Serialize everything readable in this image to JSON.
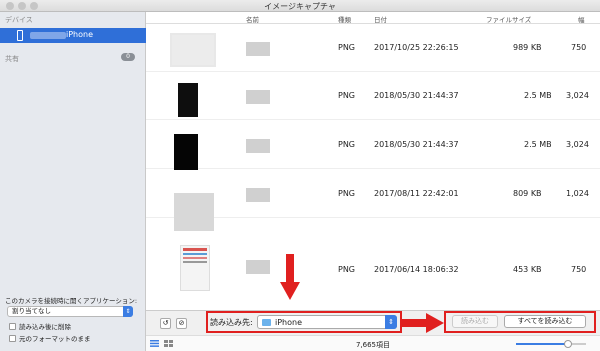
{
  "window": {
    "title": "イメージキャプチャ"
  },
  "sidebar": {
    "devices_header": "デバイス",
    "device_label": "iPhone",
    "shared_header": "共有",
    "shared_count": "0",
    "open_app_caption": "このカメラを接続時に開くアプリケーション:",
    "open_app_value": "割り当てなし",
    "delete_after_import": "読み込み後に削除",
    "keep_originals": "元のフォーマットのまま"
  },
  "table": {
    "headers": {
      "name": "名前",
      "kind": "種類",
      "date": "日付",
      "size": "ファイルサイズ",
      "width": "幅"
    },
    "rows": [
      {
        "kind": "PNG",
        "date": "2017/10/25 22:26:15",
        "size": "989 KB",
        "width": "750",
        "thumb_style": "light"
      },
      {
        "kind": "PNG",
        "date": "2018/05/30 21:44:37",
        "size": "2.5 MB",
        "width": "3,024",
        "thumb_style": "dark"
      },
      {
        "kind": "PNG",
        "date": "2018/05/30 21:44:37",
        "size": "2.5 MB",
        "width": "3,024",
        "thumb_style": "dark"
      },
      {
        "kind": "PNG",
        "date": "2017/08/11 22:42:01",
        "size": "809 KB",
        "width": "1,024",
        "thumb_style": "gray"
      },
      {
        "kind": "PNG",
        "date": "2017/06/14 18:06:32",
        "size": "453 KB",
        "width": "750",
        "thumb_style": "colorful"
      }
    ]
  },
  "toolbar": {
    "import_to_label": "読み込み先:",
    "import_to_value": "iPhone",
    "import_button": "読み込む",
    "import_all_button": "すべてを読み込む"
  },
  "status": {
    "item_count": "7,665項目"
  },
  "colors": {
    "accent": "#2f6fd8",
    "highlight_red": "#e0201f"
  }
}
